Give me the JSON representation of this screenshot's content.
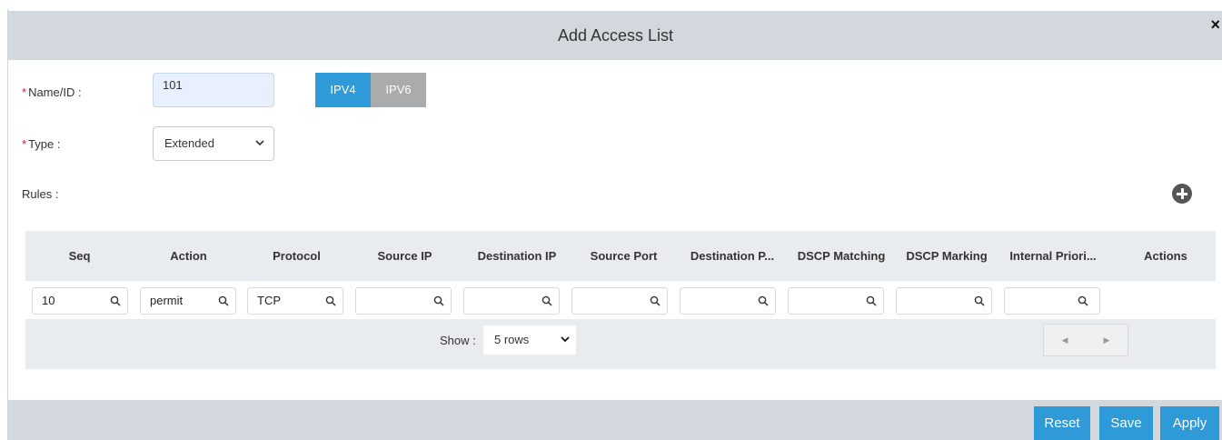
{
  "dialog": {
    "title": "Add Access List",
    "close_label": "×"
  },
  "form": {
    "name_label": "Name/ID :",
    "name_value": "101",
    "ip_versions": [
      "IPV4",
      "IPV6"
    ],
    "ip_selected": "IPV4",
    "type_label": "Type :",
    "type_value": "Extended",
    "rules_label": "Rules :",
    "required_marker": "*"
  },
  "table": {
    "columns": [
      "Seq",
      "Action",
      "Protocol",
      "Source IP",
      "Destination IP",
      "Source Port",
      "Destination P...",
      "DSCP Matching",
      "DSCP Marking",
      "Internal Priori...",
      "Actions"
    ],
    "filters": [
      "10",
      "permit",
      "TCP",
      "",
      "",
      "",
      "",
      "",
      "",
      ""
    ],
    "show_label": "Show :",
    "rows_value": "5 rows",
    "pager_prev": "◀",
    "pager_next": "▶"
  },
  "actions": {
    "reset": "Reset",
    "save": "Save",
    "apply": "Apply"
  },
  "colors": {
    "accent": "#2e9ad8",
    "header_bg": "#d3d8df",
    "required": "#e02020"
  },
  "icons": {
    "close": "close-icon",
    "add": "plus-circle-icon",
    "search": "search-icon",
    "chevron": "chevron-down-icon"
  }
}
